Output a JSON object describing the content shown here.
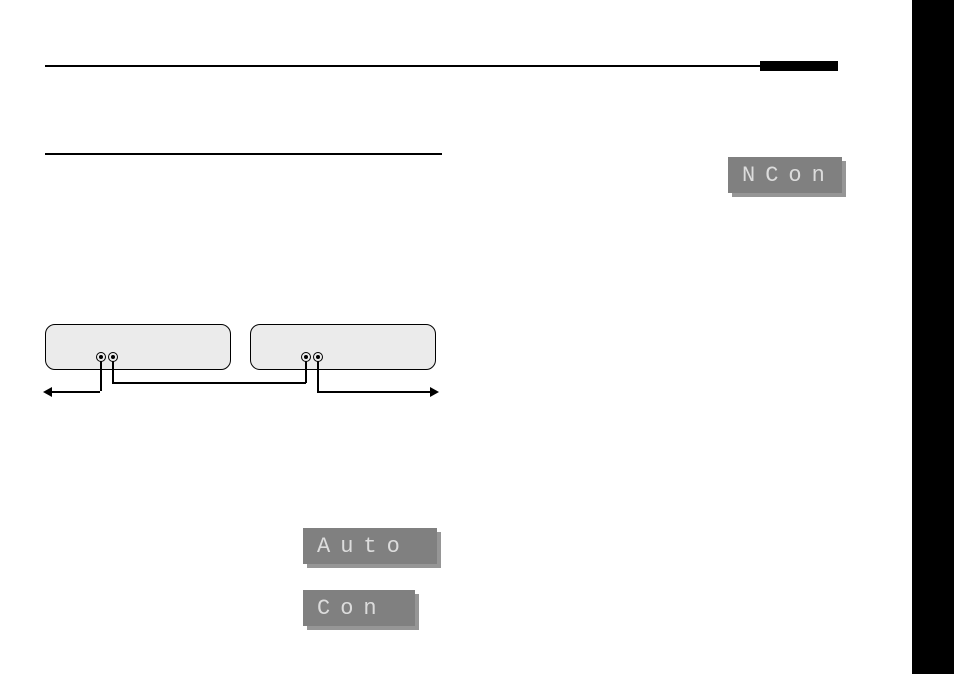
{
  "displays": {
    "ncon": "NCon",
    "auto": "Auto",
    "con": "Con"
  }
}
